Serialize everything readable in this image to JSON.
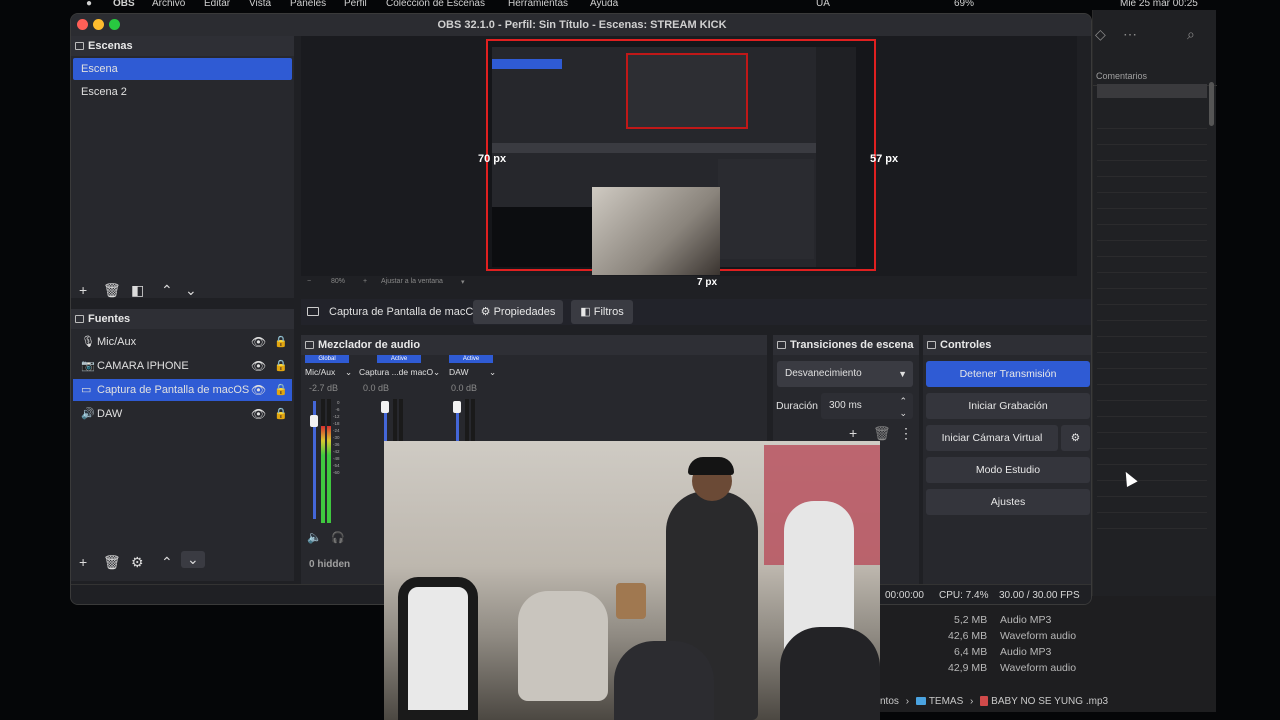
{
  "menubar": {
    "app": "OBS",
    "menus": [
      "Archivo",
      "Editar",
      "Vista",
      "Paneles",
      "Perfil",
      "Colección de Escenas",
      "Herramientas",
      "Ayuda"
    ],
    "lang": "UA",
    "battery": "69%",
    "datetime": "Mié 25 mar  00:25"
  },
  "obs": {
    "title": "OBS 32.1.0 - Perfil: Sin Título - Escenas: STREAM KICK",
    "scenes_title": "Escenas",
    "scenes": [
      "Escena",
      "Escena 2"
    ],
    "sources_title": "Fuentes",
    "sources": [
      "Mic/Aux",
      "CAMARA IPHONE",
      "Captura de Pantalla de macOS",
      "DAW"
    ],
    "preview_labels": {
      "left": "70 px",
      "right": "57 px",
      "bottom": "7 px"
    },
    "zoom": {
      "minus": "−",
      "value": "80%",
      "plus": "+",
      "fit": "Ajustar a la ventana"
    },
    "source_bar": {
      "name": "Captura de Pantalla de macC",
      "props": "Propiedades",
      "filters": "Filtros"
    },
    "mixer": {
      "title": "Mezclador de audio",
      "channels": [
        {
          "badge": "Global",
          "name": "Mic/Aux",
          "db": "-2.7 dB",
          "level": 0.78
        },
        {
          "badge": "Active",
          "name": "Captura ...de macOS",
          "db": "0.0 dB",
          "level": 0.3
        },
        {
          "badge": "Active",
          "name": "DAW",
          "db": "0.0 dB",
          "level": 0.25
        }
      ],
      "ticks": [
        "0",
        "-6",
        "-12",
        "-18",
        "-24",
        "-30",
        "-36",
        "-42",
        "-48",
        "-54",
        "-60"
      ],
      "hidden": "0 hidden"
    },
    "transitions": {
      "title": "Transiciones de escena",
      "selected": "Desvanecimiento",
      "duration_label": "Duración",
      "duration_value": "300 ms"
    },
    "controls": {
      "title": "Controles",
      "stop_stream": "Detener Transmisión",
      "start_record": "Iniciar Grabación",
      "virtual_cam": "Iniciar Cámara Virtual",
      "studio": "Modo Estudio",
      "settings": "Ajustes"
    },
    "status": {
      "time": "00:00:00",
      "cpu": "CPU: 7.4%",
      "fps": "30.00 / 30.00 FPS"
    },
    "colors": {
      "accent": "#2f5bd4",
      "preview_border": "#e02020"
    }
  },
  "finder": {
    "column": "Comentarios",
    "rows": [
      {
        "size": "5,2 MB",
        "kind": "Audio MP3"
      },
      {
        "size": "42,6 MB",
        "kind": "Waveform audio"
      },
      {
        "size": "6,4 MB",
        "kind": "Audio MP3"
      },
      {
        "size": "42,9 MB",
        "kind": "Waveform audio"
      }
    ],
    "path": {
      "prefix": "ntos",
      "folder": "TEMAS",
      "file": "BABY NO SE YUNG .mp3"
    }
  }
}
